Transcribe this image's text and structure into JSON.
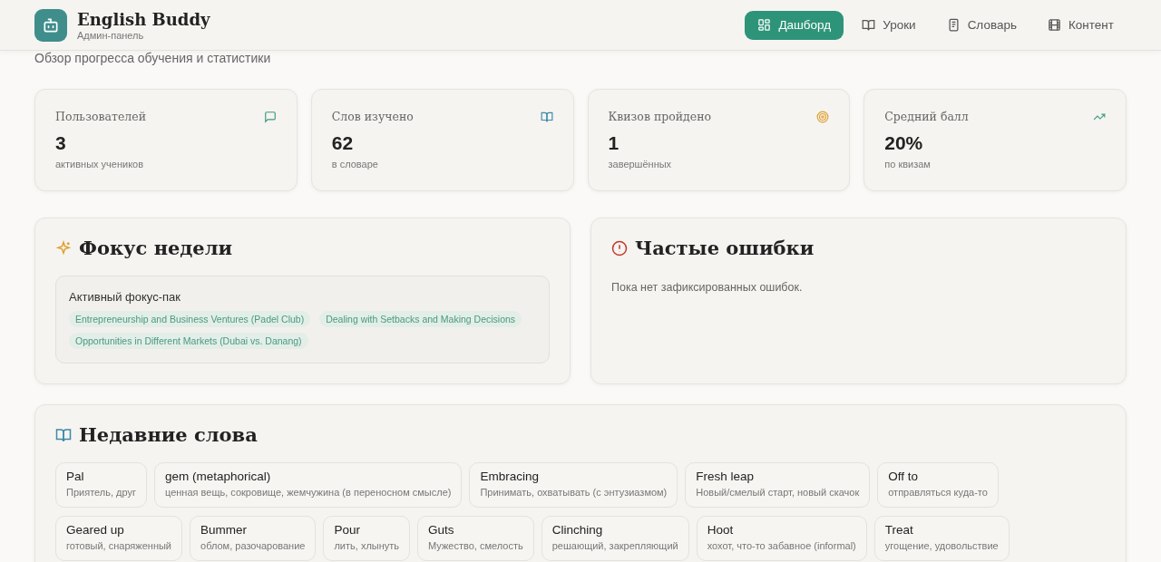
{
  "header": {
    "logo_title": "English Buddy",
    "logo_subtitle": "Админ-панель",
    "nav": [
      {
        "label": "Дашборд",
        "kind": "grid",
        "selected": true
      },
      {
        "label": "Уроки",
        "kind": "book",
        "selected": false
      },
      {
        "label": "Словарь",
        "kind": "notebook",
        "selected": false
      },
      {
        "label": "Контент",
        "kind": "film",
        "selected": false
      }
    ]
  },
  "page_subtitle": "Обзор прогресса обучения и статистики",
  "stats": [
    {
      "label": "Пользователей",
      "value": "3",
      "caption": "активных учеников",
      "kind": "chat"
    },
    {
      "label": "Слов изучено",
      "value": "62",
      "caption": "в словаре",
      "kind": "book"
    },
    {
      "label": "Квизов пройдено",
      "value": "1",
      "caption": "завершённых",
      "kind": "target"
    },
    {
      "label": "Средний балл",
      "value": "20%",
      "caption": "по квизам",
      "kind": "trend"
    }
  ],
  "focus": {
    "title": "Фокус недели",
    "pack_title": "Активный фокус-пак",
    "tags": [
      "Entrepreneurship and Business Ventures (Padel Club)",
      "Dealing with Setbacks and Making Decisions",
      "Opportunities in Different Markets (Dubai vs. Danang)"
    ]
  },
  "mistakes": {
    "title": "Частые ошибки",
    "empty_text": "Пока нет зафиксированных ошибок."
  },
  "recent_words": {
    "title": "Недавние слова",
    "words": [
      {
        "word": "Pal",
        "translation": "Приятель, друг"
      },
      {
        "word": "gem (metaphorical)",
        "translation": "ценная вещь, сокровище, жемчужина (в переносном смысле)"
      },
      {
        "word": "Embracing",
        "translation": "Принимать, охватывать (с энтузиазмом)"
      },
      {
        "word": "Fresh leap",
        "translation": "Новый/смелый старт, новый скачок"
      },
      {
        "word": "Off to",
        "translation": "отправляться куда-то"
      },
      {
        "word": "Geared up",
        "translation": "готовый, снаряженный"
      },
      {
        "word": "Bummer",
        "translation": "облом, разочарование"
      },
      {
        "word": "Pour",
        "translation": "лить, хлынуть"
      },
      {
        "word": "Guts",
        "translation": "Мужество, смелость"
      },
      {
        "word": "Clinching",
        "translation": "решающий, закрепляющий"
      },
      {
        "word": "Hoot",
        "translation": "хохот, что-то забавное (informal)"
      },
      {
        "word": "Treat",
        "translation": "угощение, удовольствие"
      }
    ]
  }
}
